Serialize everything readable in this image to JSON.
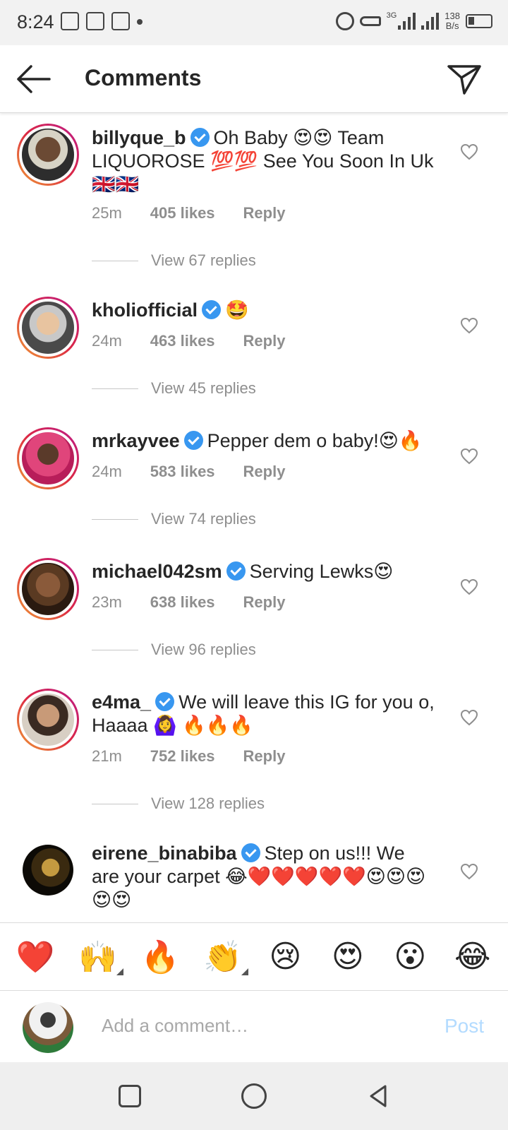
{
  "status_bar": {
    "time": "8:24",
    "network": "3G",
    "speed_top": "138",
    "speed_bottom": "B/s"
  },
  "header": {
    "title": "Comments"
  },
  "comments": [
    {
      "username": "billyque_b",
      "text": "Oh Baby 😍😍 Team LIQUOROSE 💯💯 See You Soon In Uk 🇬🇧🇬🇧",
      "time": "25m",
      "likes": "405 likes",
      "reply": "Reply",
      "view_replies": "View 67 replies"
    },
    {
      "username": "kholiofficial",
      "text": "🤩",
      "time": "24m",
      "likes": "463 likes",
      "reply": "Reply",
      "view_replies": "View 45 replies"
    },
    {
      "username": "mrkayvee",
      "text": "Pepper dem o baby!😍🔥",
      "time": "24m",
      "likes": "583 likes",
      "reply": "Reply",
      "view_replies": "View 74 replies"
    },
    {
      "username": "michael042sm",
      "text": "Serving Lewks😍",
      "time": "23m",
      "likes": "638 likes",
      "reply": "Reply",
      "view_replies": "View 96 replies"
    },
    {
      "username": "e4ma_",
      "text": "We will leave this IG for you o, Haaaa 🙆‍♀️ 🔥🔥🔥",
      "time": "21m",
      "likes": "752 likes",
      "reply": "Reply",
      "view_replies": "View 128 replies"
    },
    {
      "username": "eirene_binabiba",
      "text": "Step on us!!! We are your carpet 😂❤️❤️❤️❤️❤️😍😍😍😍😍"
    }
  ],
  "reactions": [
    "❤️",
    "🙌",
    "🔥",
    "👏",
    "😢",
    "😍",
    "😮",
    "😂"
  ],
  "composer": {
    "placeholder": "Add a comment…",
    "post_label": "Post"
  },
  "colors": {
    "verified": "#3897f0",
    "meta_gray": "#8e8e8e",
    "post_disabled": "#b3dbff"
  }
}
